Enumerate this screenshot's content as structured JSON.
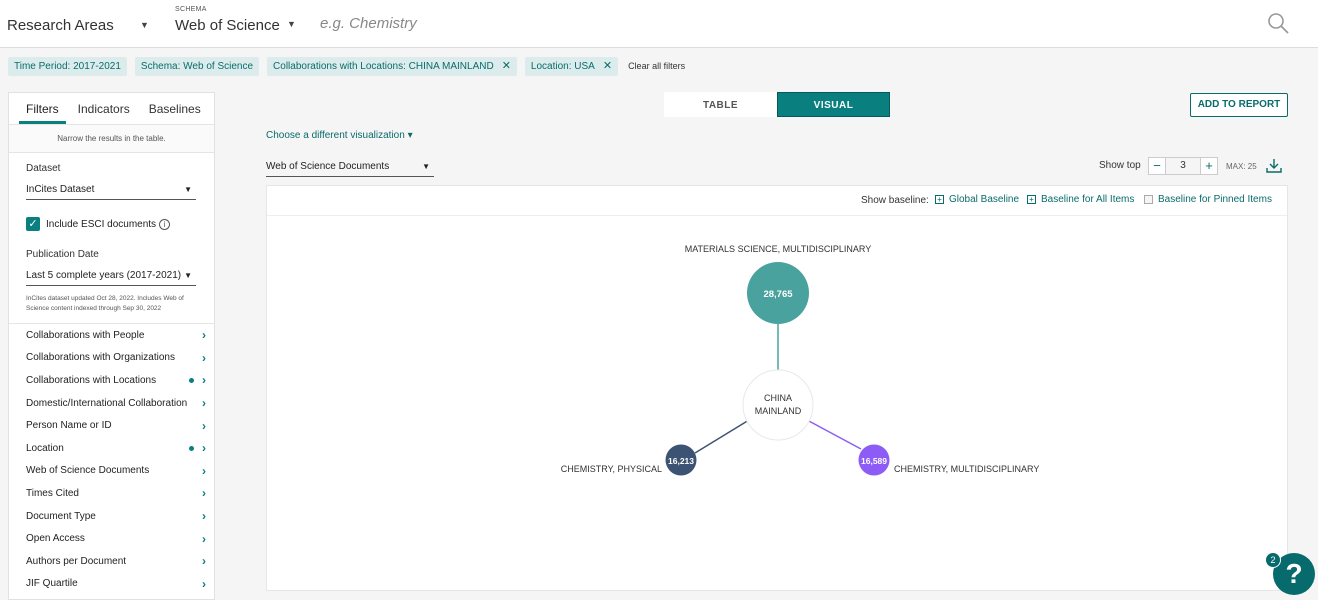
{
  "topbar": {
    "area_select": "Research Areas",
    "schema_label": "SCHEMA",
    "schema_value": "Web of Science",
    "search_placeholder": "e.g. Chemistry"
  },
  "chips": [
    {
      "label": "Time Period: 2017-2021",
      "removable": false
    },
    {
      "label": "Schema: Web of Science",
      "removable": false
    },
    {
      "label": "Collaborations with Locations: CHINA MAINLAND",
      "removable": true
    },
    {
      "label": "Location: USA",
      "removable": true
    }
  ],
  "clear_all": "Clear all filters",
  "sidebar": {
    "tabs": [
      "Filters",
      "Indicators",
      "Baselines"
    ],
    "narrow_text": "Narrow the results in the table.",
    "dataset_label": "Dataset",
    "dataset_value": "InCites Dataset",
    "esci_label": "Include ESCI documents",
    "pub_date_label": "Publication Date",
    "pub_date_value": "Last 5 complete years (2017-2021)",
    "updated_text": "InCites dataset updated Oct 28, 2022. Includes Web of Science content indexed through Sep 30, 2022",
    "filters": [
      {
        "label": "Collaborations with People",
        "active": false
      },
      {
        "label": "Collaborations with Organizations",
        "active": false
      },
      {
        "label": "Collaborations with Locations",
        "active": true
      },
      {
        "label": "Domestic/International Collaboration",
        "active": false
      },
      {
        "label": "Person Name or ID",
        "active": false
      },
      {
        "label": "Location",
        "active": true
      },
      {
        "label": "Web of Science Documents",
        "active": false
      },
      {
        "label": "Times Cited",
        "active": false
      },
      {
        "label": "Document Type",
        "active": false
      },
      {
        "label": "Open Access",
        "active": false
      },
      {
        "label": "Authors per Document",
        "active": false
      },
      {
        "label": "JIF Quartile",
        "active": false
      }
    ]
  },
  "view_toggle": {
    "table": "TABLE",
    "visual": "VISUAL"
  },
  "add_to_report": "ADD TO REPORT",
  "choose_viz": "Choose a different visualization ▾",
  "metric_select": "Web of Science Documents",
  "show_top": {
    "label": "Show top",
    "value": "3",
    "max": "MAX: 25"
  },
  "baseline": {
    "label": "Show baseline:",
    "global": "Global Baseline",
    "all_items": "Baseline for All Items",
    "pinned": "Baseline for Pinned Items"
  },
  "chart_data": {
    "type": "network",
    "center": {
      "label": [
        "CHINA",
        "MAINLAND"
      ]
    },
    "nodes": [
      {
        "name": "MATERIALS SCIENCE, MULTIDISCIPLINARY",
        "value": "28,765",
        "color": "#4aa29e"
      },
      {
        "name": "CHEMISTRY, PHYSICAL",
        "value": "16,213",
        "color": "#3c5373"
      },
      {
        "name": "CHEMISTRY, MULTIDISCIPLINARY",
        "value": "16,589",
        "color": "#8d5cf6"
      }
    ]
  },
  "help": {
    "badge": "2",
    "icon": "?"
  }
}
